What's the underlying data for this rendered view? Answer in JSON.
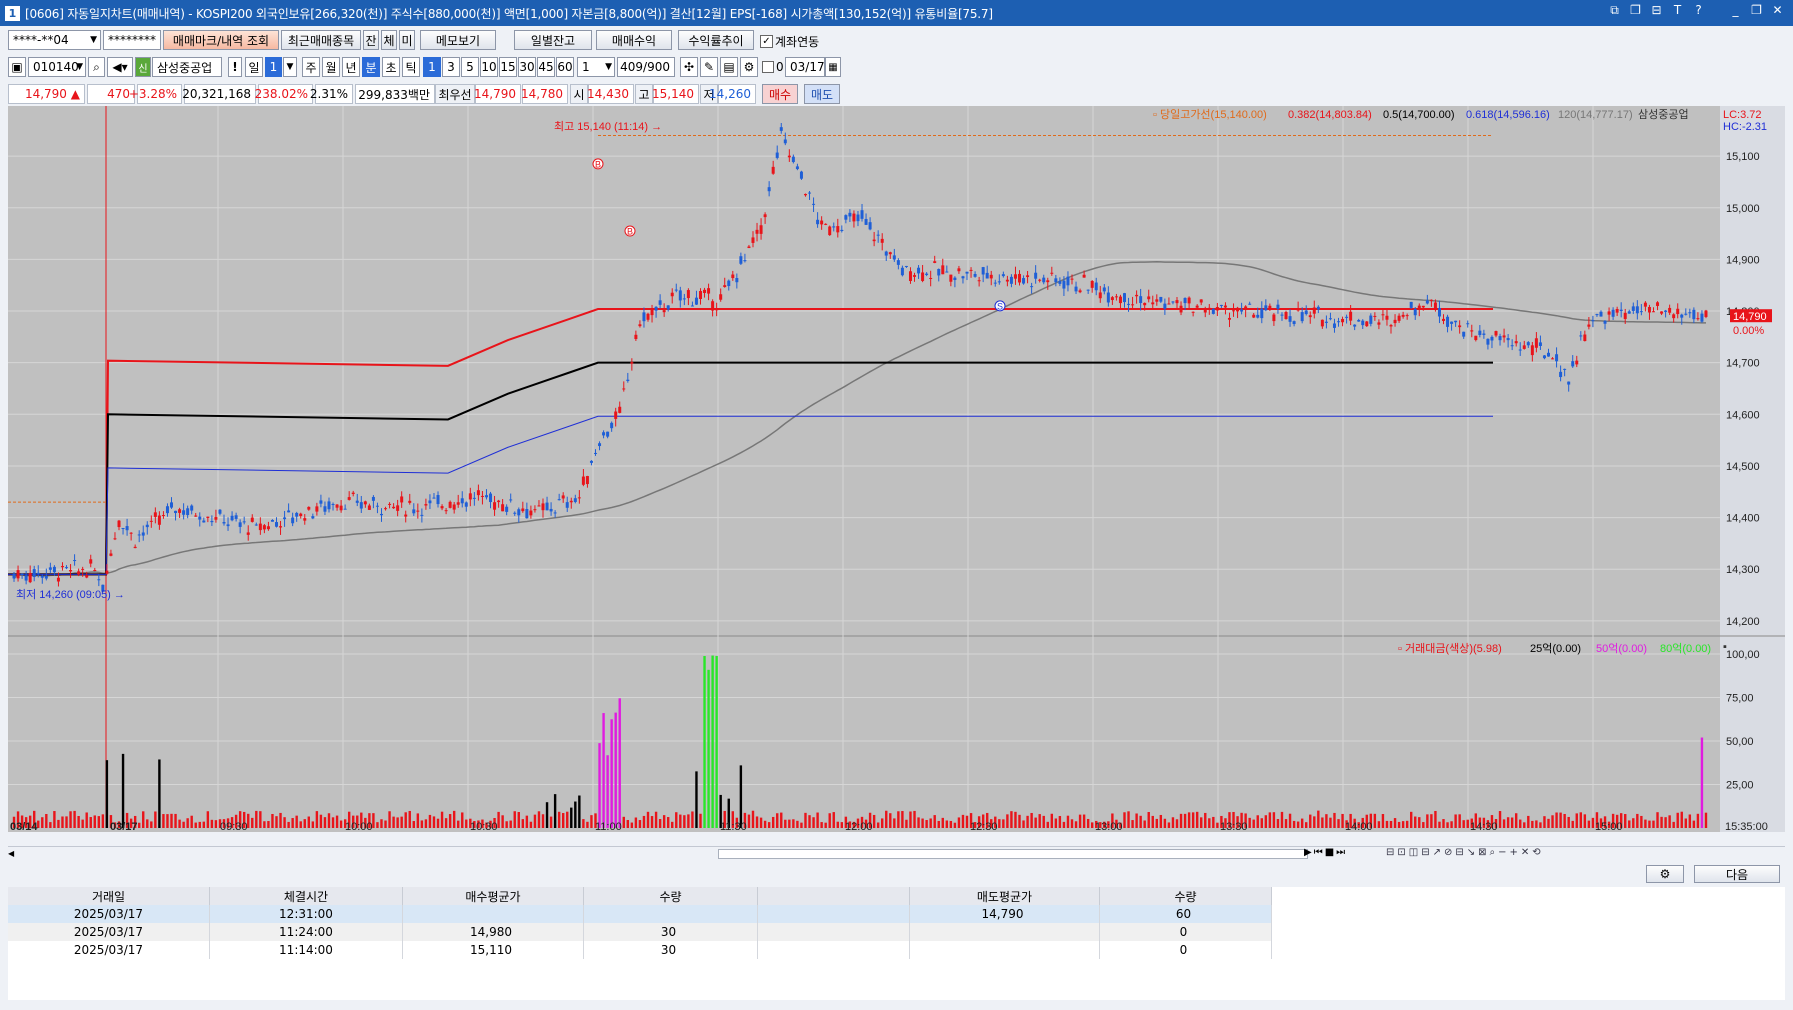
{
  "window": {
    "title": "[0606] 자동일지차트(매매내역) - KOSPI200 외국인보유[266,320(천)] 주식수[880,000(천)] 액면[1,000] 자본금[8,800(억)] 결산[12월] EPS[-168] 시가총액[130,152(억)] 유통비율[75.7]",
    "icon": "1"
  },
  "toolbar1": {
    "account": "****-**04",
    "password": "********",
    "btn_trade_mark": "매매마크/내역 조회",
    "btn_recent": "최근매매종목",
    "btn_jan": "잔",
    "btn_che": "체",
    "btn_mi": "미",
    "btn_memo": "메모보기",
    "btn_daily": "일별잔고",
    "btn_profit": "매매수익",
    "btn_rate": "수익률추이",
    "chk_link": "계좌연동"
  },
  "toolbar2": {
    "code": "010140",
    "name": "삼성중공업",
    "periods": [
      "일",
      "1",
      "주",
      "월",
      "년",
      "분",
      "초",
      "틱"
    ],
    "minutes": [
      "1",
      "3",
      "5",
      "10",
      "15",
      "30",
      "45",
      "60"
    ],
    "count": "1",
    "range": "409/900",
    "zero": "0",
    "date": "03/17"
  },
  "quote": {
    "price": "14,790",
    "arrow": "▲",
    "change": "470",
    "pct": "+3.28%",
    "volume": "20,321,168",
    "vol_ratio": "238.02%",
    "turnover": "2.31%",
    "amount": "299,833백만",
    "best_label": "최우선",
    "ask": "14,790",
    "bid": "14,780",
    "open_label": "시",
    "open": "14,430",
    "high_label": "고",
    "high": "15,140",
    "low_label": "저",
    "low": "14,260",
    "buy": "매수",
    "sell": "매도"
  },
  "chart_data": {
    "type": "candlestick",
    "price_axis": {
      "ticks": [
        "15,100",
        "15,000",
        "14,900",
        "14,800",
        "14,700",
        "14,600",
        "14,500",
        "14,400",
        "14,300",
        "14,200"
      ],
      "range": [
        14190,
        15170
      ]
    },
    "volume_axis": {
      "ticks": [
        "100,00",
        "75,00",
        "50,00",
        "25,00"
      ],
      "range": [
        0,
        100
      ]
    },
    "x_labels": [
      "03/14",
      "03/17",
      "09:30",
      "10:00",
      "10:30",
      "11:00",
      "11:30",
      "12:00",
      "12:30",
      "13:00",
      "13:30",
      "14:00",
      "14:30",
      "15:00",
      "15:35:00"
    ],
    "legend_price": {
      "label": "당일고가선(15,140.00)",
      "fib382": "0.382(14,803.84)",
      "fib50": "0.5(14,700.00)",
      "fib618": "0.618(14,596.16)",
      "ma": "120(14,777.17)",
      "name": "삼성중공업"
    },
    "legend_volume": {
      "label": "거래대금(색상)(5.98)",
      "v25": "25억(0.00)",
      "v50": "50억(0.00)",
      "v80": "80억(0.00)"
    },
    "lc": "LC:3.72",
    "hc": "HC:-2.31",
    "current_price_tag": "14,790",
    "current_pct_tag": "0.00%",
    "high_note": "최고 15,140 (11:14)",
    "low_note": "최저 14,260 (09:05)",
    "levels": {
      "day_high": 15140,
      "fib382": 14803.84,
      "fib50": 14700,
      "fib618": 14596.16
    },
    "markers": [
      {
        "label": "B",
        "time": "11:14"
      },
      {
        "label": "B",
        "time": "11:24"
      },
      {
        "label": "S",
        "time": "12:31"
      }
    ],
    "colors": {
      "up": "#e8141a",
      "down": "#1f5fd6",
      "ma": "#777777",
      "fib382": "#e8141a",
      "fib50": "#000000",
      "fib618": "#1f2fd6",
      "day_high": "#e06a1a"
    }
  },
  "table": {
    "headers": [
      "거래일",
      "체결시간",
      "매수평균가",
      "수량",
      "",
      "매도평균가",
      "수량"
    ],
    "rows": [
      [
        "2025/03/17",
        "12:31:00",
        "",
        "",
        "",
        "14,790",
        "60"
      ],
      [
        "2025/03/17",
        "11:24:00",
        "14,980",
        "30",
        "",
        "",
        "0"
      ],
      [
        "2025/03/17",
        "11:14:00",
        "15,110",
        "30",
        "",
        "",
        "0"
      ]
    ],
    "next_btn": "다음"
  }
}
